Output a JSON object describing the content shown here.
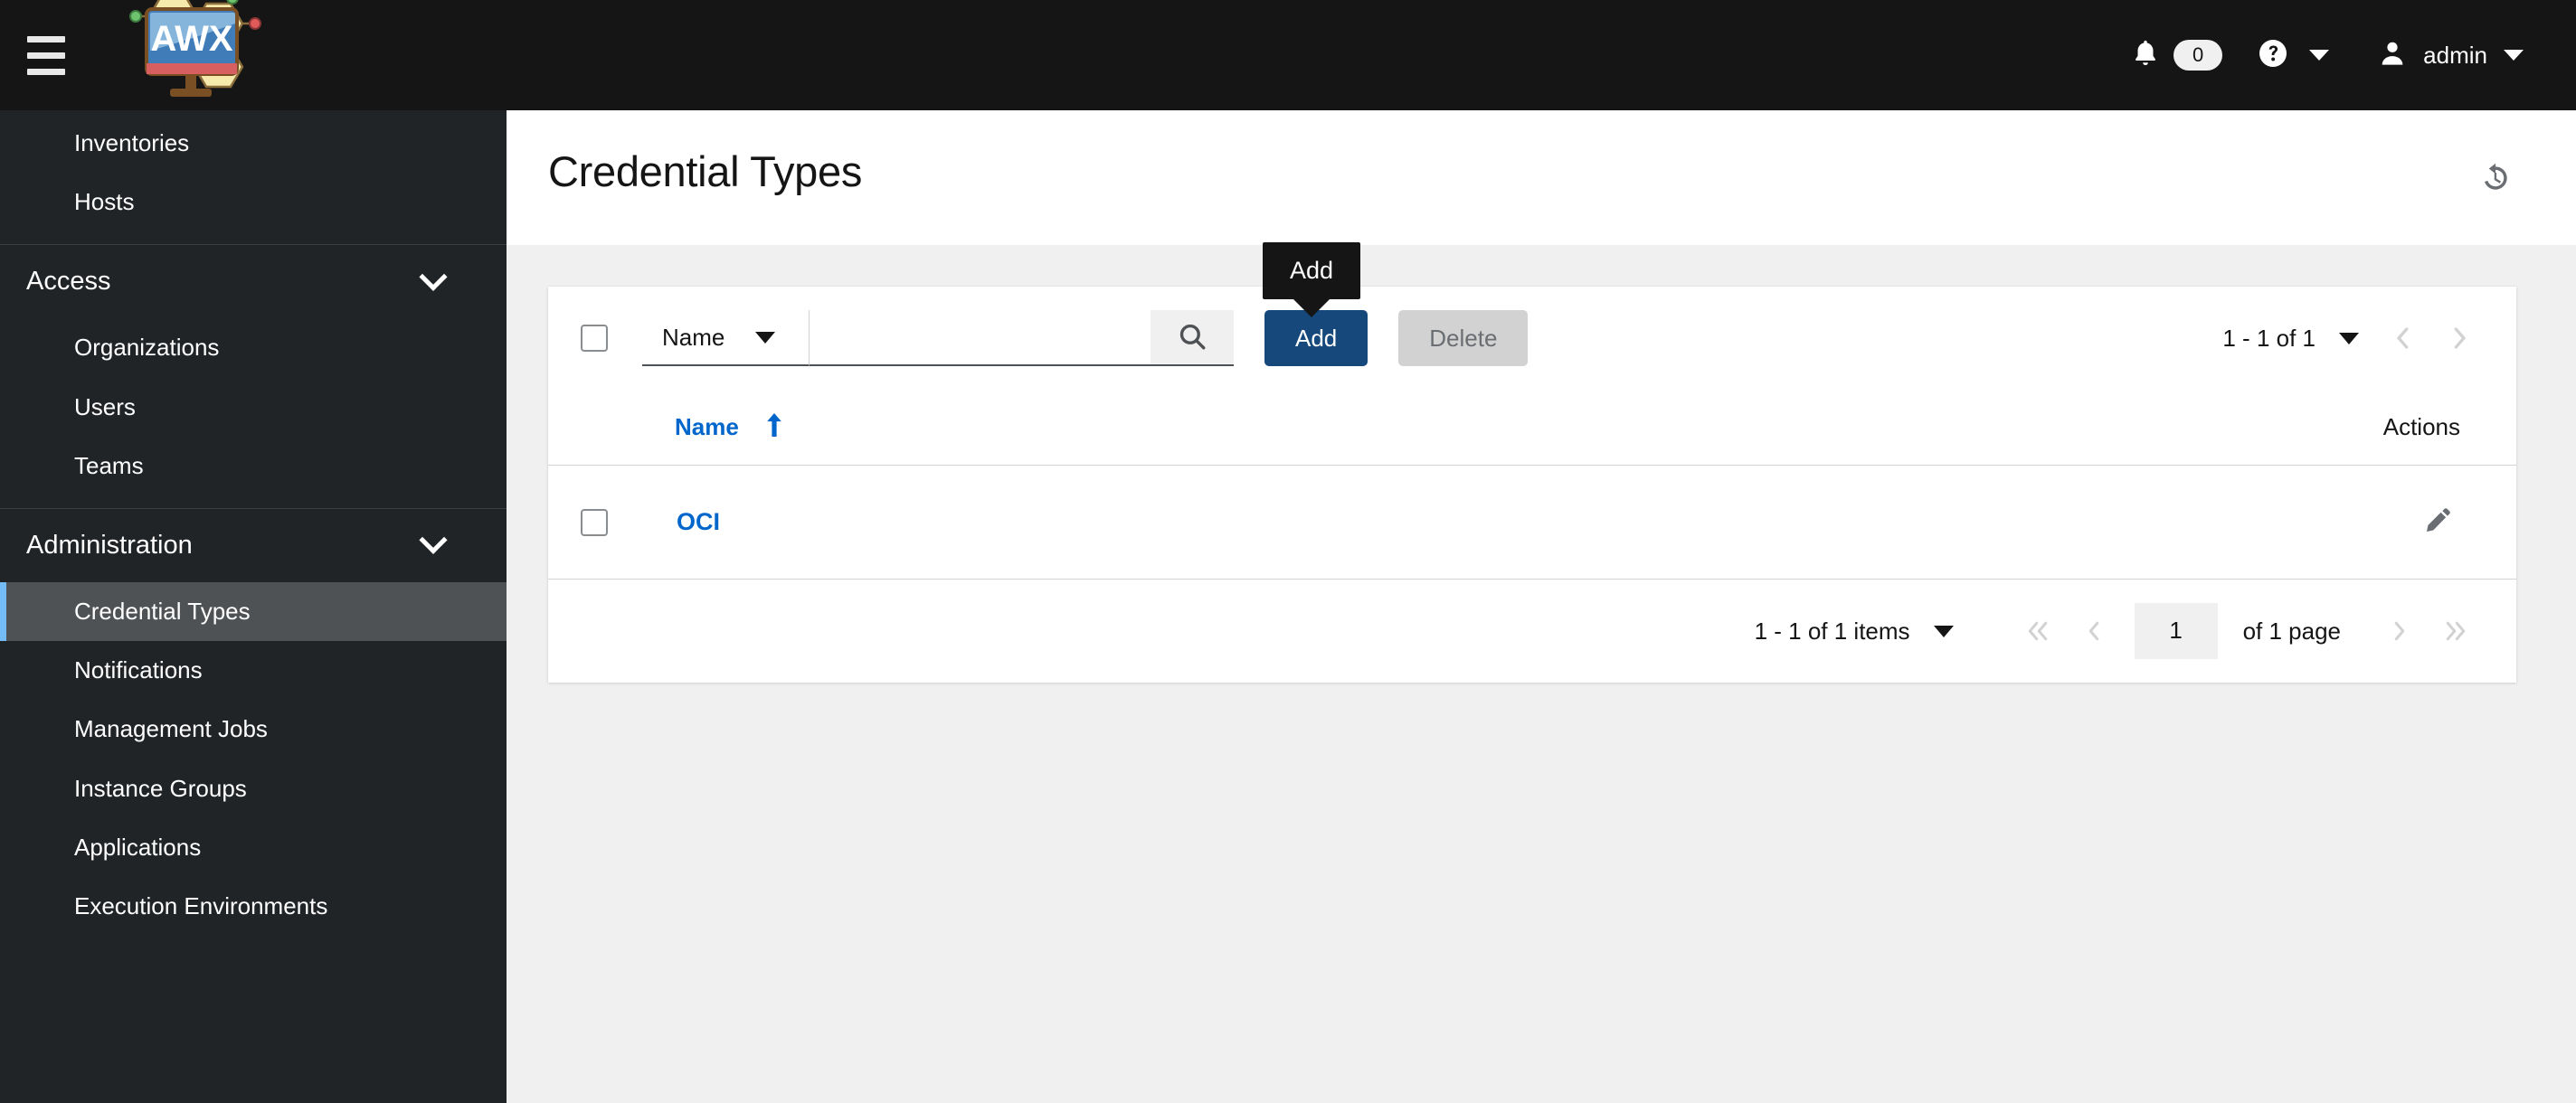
{
  "masthead": {
    "brand_text": "AWX",
    "hamburger_label": "Global navigation",
    "notifications_count": "0",
    "user_name": "admin"
  },
  "sidebar": {
    "top_items": [
      {
        "label": "Inventories",
        "active": false
      },
      {
        "label": "Hosts",
        "active": false
      }
    ],
    "groups": [
      {
        "title": "Access",
        "items": [
          {
            "label": "Organizations",
            "active": false
          },
          {
            "label": "Users",
            "active": false
          },
          {
            "label": "Teams",
            "active": false
          }
        ]
      },
      {
        "title": "Administration",
        "items": [
          {
            "label": "Credential Types",
            "active": true
          },
          {
            "label": "Notifications",
            "active": false
          },
          {
            "label": "Management Jobs",
            "active": false
          },
          {
            "label": "Instance Groups",
            "active": false
          },
          {
            "label": "Applications",
            "active": false
          },
          {
            "label": "Execution Environments",
            "active": false
          }
        ]
      }
    ]
  },
  "page": {
    "title": "Credential Types",
    "history_icon": "history-icon"
  },
  "toolbar": {
    "select_all_label": "Select all",
    "filter_field": "Name",
    "search_value": "",
    "search_placeholder": "",
    "search_icon": "search-icon",
    "add_label": "Add",
    "delete_label": "Delete",
    "tooltip_text": "Add",
    "pagination_summary": "1 - 1 of 1"
  },
  "table": {
    "columns": {
      "name": "Name",
      "actions": "Actions"
    },
    "sort_direction": "asc",
    "rows": [
      {
        "name": "OCI",
        "edit_icon": "pencil-icon"
      }
    ]
  },
  "footer_pagination": {
    "items_summary": "1 - 1 of 1 items",
    "current_page": "1",
    "of_pages": "of 1 page"
  },
  "colors": {
    "masthead_bg": "#151515",
    "sidebar_bg": "#212427",
    "active_item_bg": "#4f5255",
    "active_item_accent": "#73bcf7",
    "primary_button": "#16487b",
    "link_blue": "#0066cc",
    "content_bg": "#f0f0f0"
  }
}
